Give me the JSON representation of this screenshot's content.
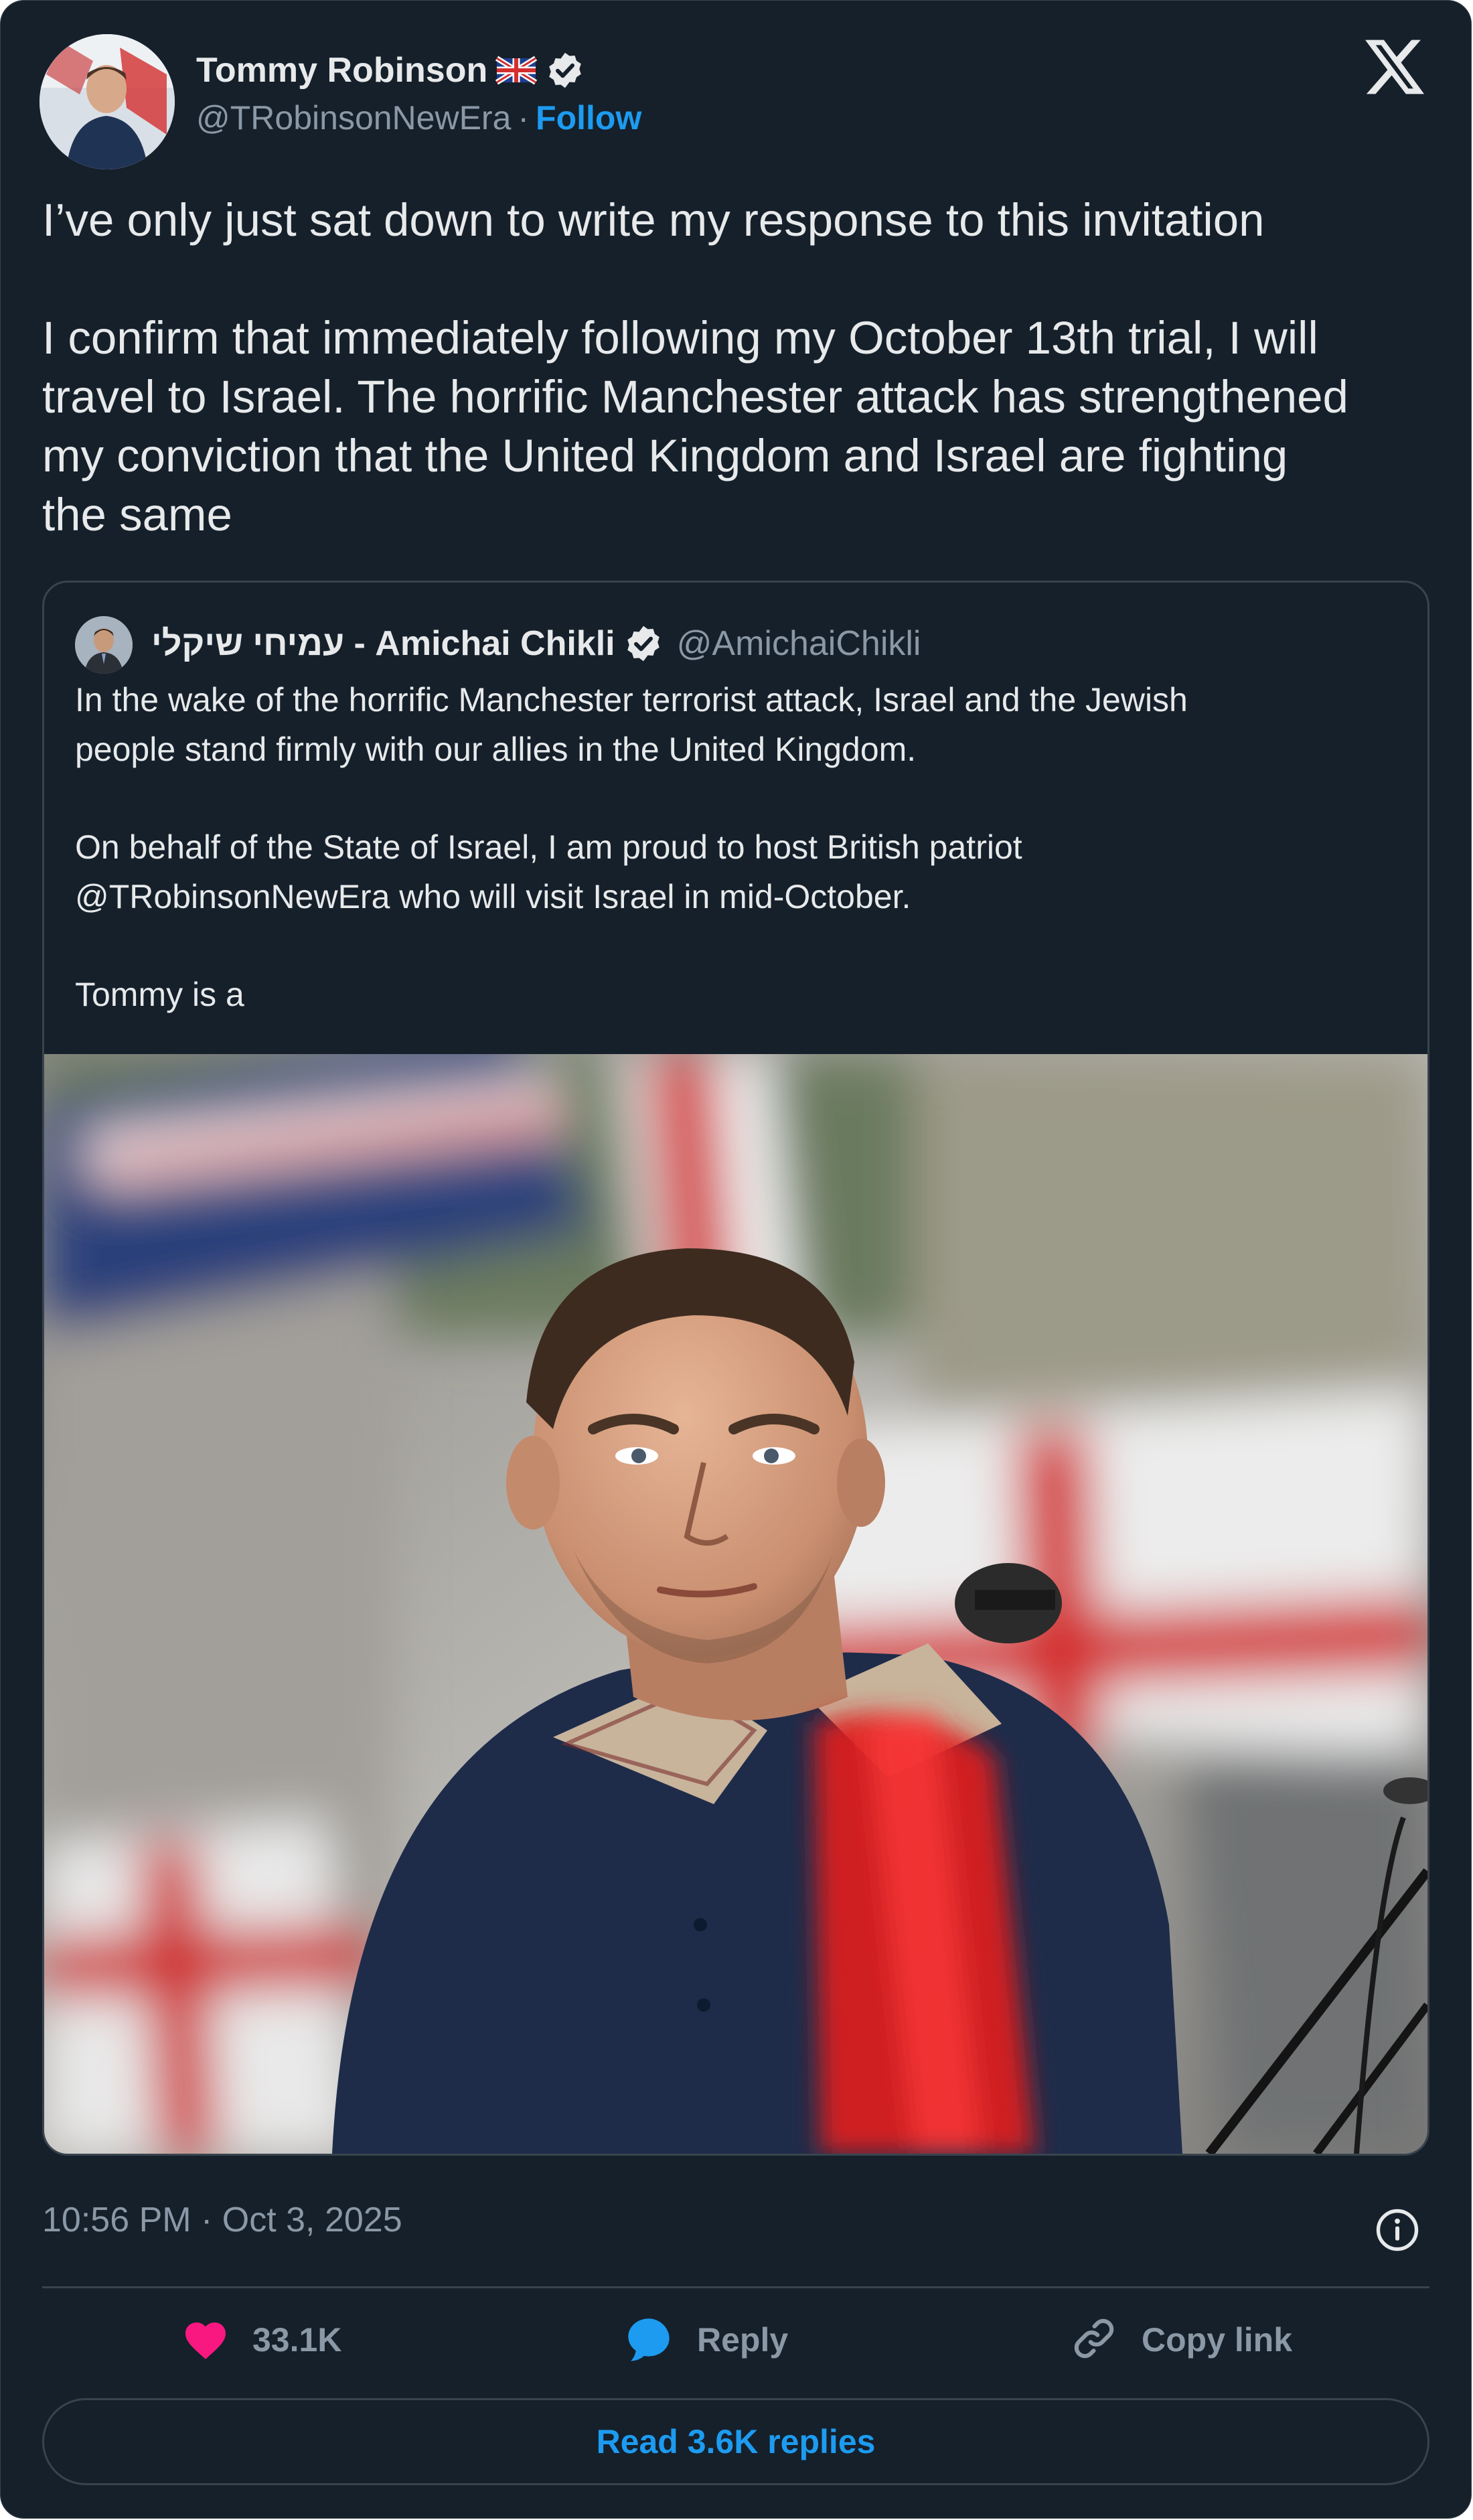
{
  "tweet": {
    "author_name": "Tommy Robinson",
    "author_flag": "uk-flag-icon",
    "author_verified": true,
    "author_handle": "@TRobinsonNewEra",
    "separator": "·",
    "follow_label": "Follow",
    "text_lines": [
      "I’ve only just sat down to write my response to this invitation",
      "I confirm that immediately following my October 13th trial, I will",
      "travel to Israel. The horrific Manchester attack has strengthened",
      "my conviction that the United Kingdom and Israel are fighting",
      "the same"
    ],
    "timestamp": "10:56 PM · Oct 3, 2025"
  },
  "quoted_tweet": {
    "author_name": "עמיחי שיקלי - Amichai Chikli",
    "author_verified": true,
    "author_handle": "@AmichaiChikli",
    "text_lines": [
      "In the wake of the horrific Manchester terrorist attack, Israel and the Jewish",
      "people stand firmly with our allies in the United Kingdom.",
      "On behalf of the State of Israel, I am proud to host British patriot",
      "@TRobinsonNewEra who will visit Israel in mid-October.",
      "Tommy is a"
    ]
  },
  "actions": {
    "like_count": "33.1K",
    "reply_label": "Reply",
    "copy_link_label": "Copy link",
    "read_replies_label": "Read 3.6K replies"
  },
  "colors": {
    "background": "#15202b",
    "border": "#38444d",
    "text_primary": "#e7e9ea",
    "text_secondary": "#8b98a5",
    "accent": "#1d9bf0",
    "like": "#f91880"
  }
}
